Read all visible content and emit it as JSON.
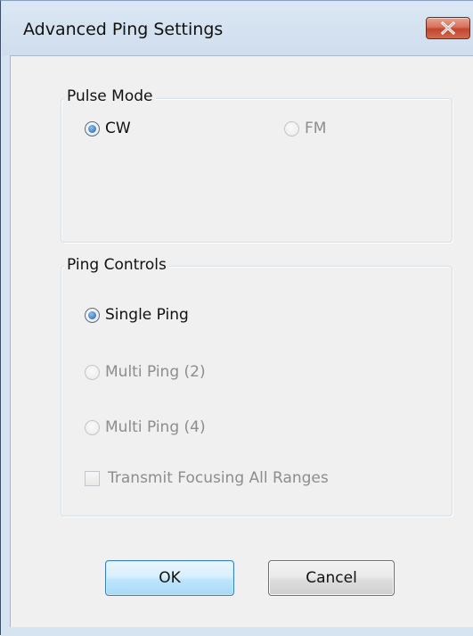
{
  "window": {
    "title": "Advanced Ping Settings",
    "close_icon": "close-icon"
  },
  "pulse_mode": {
    "label": "Pulse Mode",
    "options": [
      {
        "label": "CW",
        "selected": true,
        "enabled": true
      },
      {
        "label": "FM",
        "selected": false,
        "enabled": false
      }
    ]
  },
  "ping_controls": {
    "label": "Ping Controls",
    "options": [
      {
        "label": "Single Ping",
        "selected": true,
        "enabled": true
      },
      {
        "label": "Multi Ping (2)",
        "selected": false,
        "enabled": false
      },
      {
        "label": "Multi Ping (4)",
        "selected": false,
        "enabled": false
      }
    ],
    "transmit_focusing": {
      "label": "Transmit Focusing All Ranges",
      "checked": false,
      "enabled": false
    }
  },
  "buttons": {
    "ok_label": "OK",
    "cancel_label": "Cancel"
  },
  "colors": {
    "frame": "#d6e3f1",
    "client": "#f0f0f0",
    "close_button": "#c2452f",
    "radio_selected": "#1f5fa8",
    "disabled_text": "#8d8d8d",
    "default_button_border": "#3c7fb1"
  }
}
